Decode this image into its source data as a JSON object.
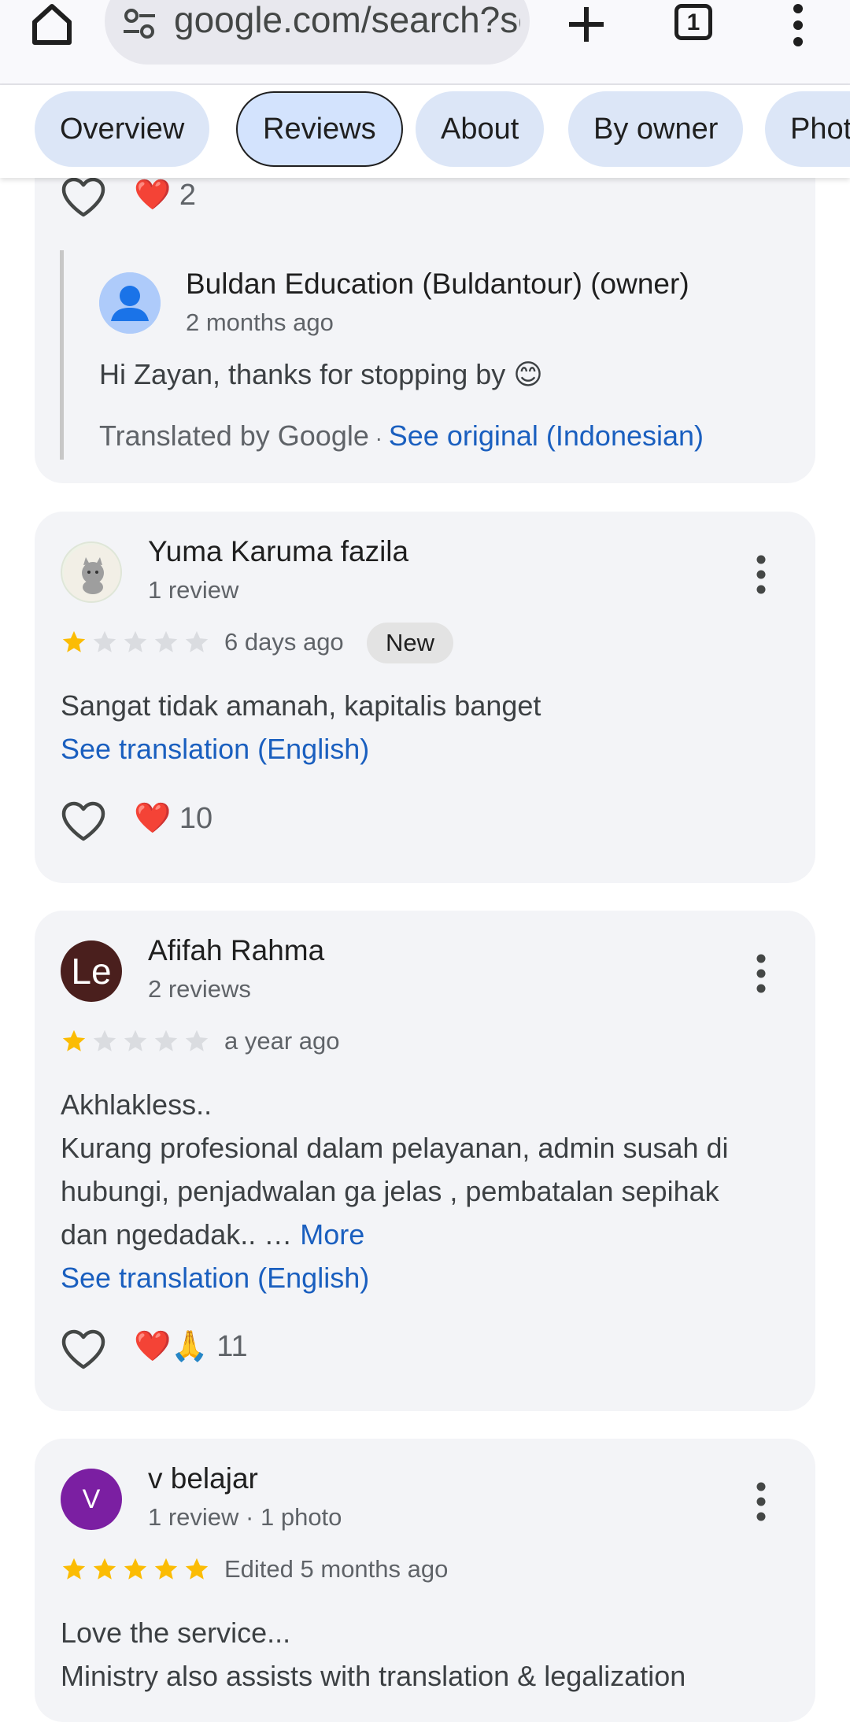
{
  "browser": {
    "url": "google.com/search?sca_esv",
    "tab_count": "1"
  },
  "chips": [
    {
      "label": "Overview"
    },
    {
      "label": "Reviews"
    },
    {
      "label": "About"
    },
    {
      "label": "By owner"
    },
    {
      "label": "Photos"
    }
  ],
  "previous_review": {
    "reaction_count": "2",
    "owner_reply": {
      "name": "Buldan Education (Buldantour) (owner)",
      "time": "2 months ago",
      "text": "Hi Zayan, thanks for stopping by 😊",
      "translated_by": "Translated by Google",
      "separator": " · ",
      "see_original": "See original (Indonesian)"
    }
  },
  "reviews": [
    {
      "name": "Yuma Karuma fazila",
      "meta": "1 review",
      "rating": 1,
      "time": "6 days ago",
      "badge": "New",
      "text": "Sangat tidak amanah, kapitalis banget",
      "see_translation": "See translation (English)",
      "reactions": "❤️",
      "reaction_count": "10"
    },
    {
      "name": "Afifah Rahma",
      "meta": "2 reviews",
      "avatar_text": "Le",
      "rating": 1,
      "time": "a year ago",
      "text_lines": [
        "Akhlakless..",
        "Kurang profesional dalam pelayanan, admin susah di",
        "hubungi, penjadwalan ga jelas , pembatalan sepihak",
        "dan ngedadak.. …"
      ],
      "more": "More",
      "see_translation": "See translation (English)",
      "reactions": "❤️🙏",
      "reaction_count": "11"
    },
    {
      "name": "v belajar",
      "meta": "1 review · 1 photo",
      "avatar_text": "V",
      "rating": 5,
      "time": "Edited 5 months ago",
      "text_lines": [
        "Love the service...",
        "Ministry also assists with translation & legalization"
      ]
    }
  ],
  "colors": {
    "star_filled": "#fbbc04",
    "star_empty": "#dadce0",
    "link": "#1a5fbf",
    "card_bg": "#f3f4f7",
    "chip_bg": "#dce6f7",
    "avatar_purple": "#7b1fa2"
  },
  "icons": {
    "home": "home-icon",
    "site_settings": "tune-icon",
    "new_tab": "plus-icon",
    "menu": "more-vert-icon",
    "like": "heart-outline-icon",
    "review_menu": "more-vert-icon"
  }
}
